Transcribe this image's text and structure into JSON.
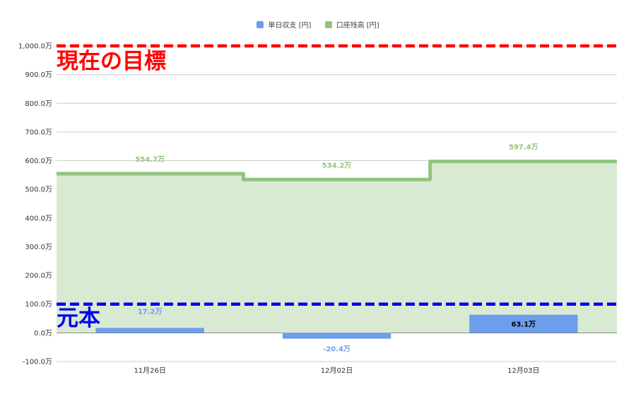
{
  "chart_data": {
    "type": "bar",
    "categories": [
      "11月26日",
      "12月02日",
      "12月03日"
    ],
    "series": [
      {
        "name": "単日収支 [円]",
        "kind": "bar",
        "color": "#6d9eeb",
        "values": [
          17.2,
          -20.4,
          63.1
        ],
        "labels": [
          "17.2万",
          "-20.4万",
          "63.1万"
        ]
      },
      {
        "name": "口座残高 [円]",
        "kind": "stepped-area",
        "color": "#93c47d",
        "fill": "#d9ead3",
        "values": [
          554.7,
          534.2,
          597.4
        ],
        "labels": [
          "554.7万",
          "534.2万",
          "597.4万"
        ]
      }
    ],
    "yticks": [
      "1,000.0万",
      "900.0万",
      "800.0万",
      "700.0万",
      "600.0万",
      "500.0万",
      "400.0万",
      "300.0万",
      "200.0万",
      "100.0万",
      "0.0万",
      "-100.0万"
    ],
    "ylim": [
      -100,
      1000
    ],
    "grid": true,
    "legend_position": "top",
    "reference_lines": [
      {
        "value": 1000,
        "label": "現在の目標",
        "color": "#ff0000"
      },
      {
        "value": 100,
        "label": "元本",
        "color": "#0000ee"
      }
    ]
  }
}
